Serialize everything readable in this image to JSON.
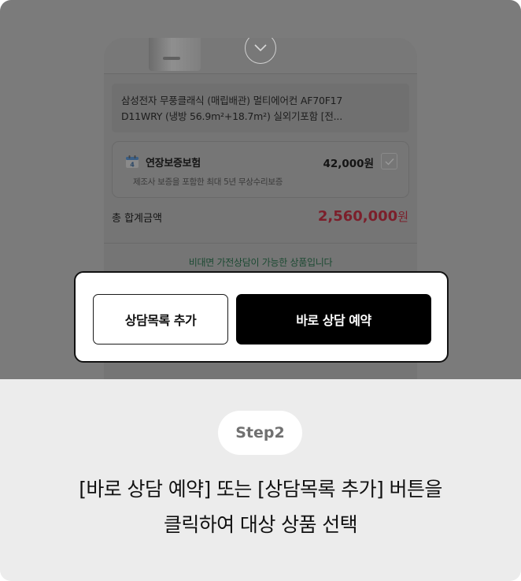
{
  "colors": {
    "accent_red": "#e0263f",
    "notice_green": "#29a35f",
    "button_black": "#000000",
    "overlay_gray": "#7b7b7b",
    "caption_bg": "#ececec"
  },
  "icons": {
    "collapse": "chevron-down-icon",
    "calendar": "calendar-icon",
    "checkbox": "check-icon"
  },
  "product": {
    "title_line1": "삼성전자 무풍클래식 (매립배관) 멀티에어컨 AF70F17",
    "title_line2": "D11WRY (냉방 56.9m²+18.7m²) 실외기포함 [전..."
  },
  "insurance": {
    "calendar_day": "4",
    "title": "연장보증보험",
    "price": "42,000원",
    "description": "제조사 보증을 포함한 최대 5년 무상수리보증",
    "checked": true
  },
  "total": {
    "label": "총 합계금액",
    "amount": "2,560,000",
    "unit": "원"
  },
  "notice": "비대면 가전상담이 가능한 상품입니다",
  "buttons": {
    "add_to_list": "상담목록 추가",
    "reserve_now": "바로 상담 예약"
  },
  "step": {
    "badge": "Step2",
    "caption_line1": "[바로 상담 예약] 또는 [상담목록 추가] 버튼을",
    "caption_line2": "클릭하여 대상 상품 선택"
  }
}
